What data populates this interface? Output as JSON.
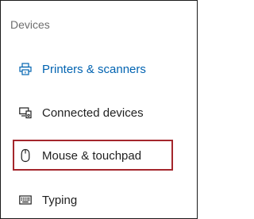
{
  "section": {
    "header": "Devices"
  },
  "nav": {
    "items": [
      {
        "label": "Printers & scanners",
        "icon": "printer-icon",
        "active": true
      },
      {
        "label": "Connected devices",
        "icon": "connected-devices-icon",
        "active": false
      },
      {
        "label": "Mouse & touchpad",
        "icon": "mouse-icon",
        "active": false,
        "highlighted": true
      },
      {
        "label": "Typing",
        "icon": "keyboard-icon",
        "active": false
      }
    ]
  },
  "colors": {
    "accent": "#0063b1",
    "highlight_border": "#a4262c",
    "text": "#1f1f1f",
    "header_text": "#6d6d6d"
  }
}
